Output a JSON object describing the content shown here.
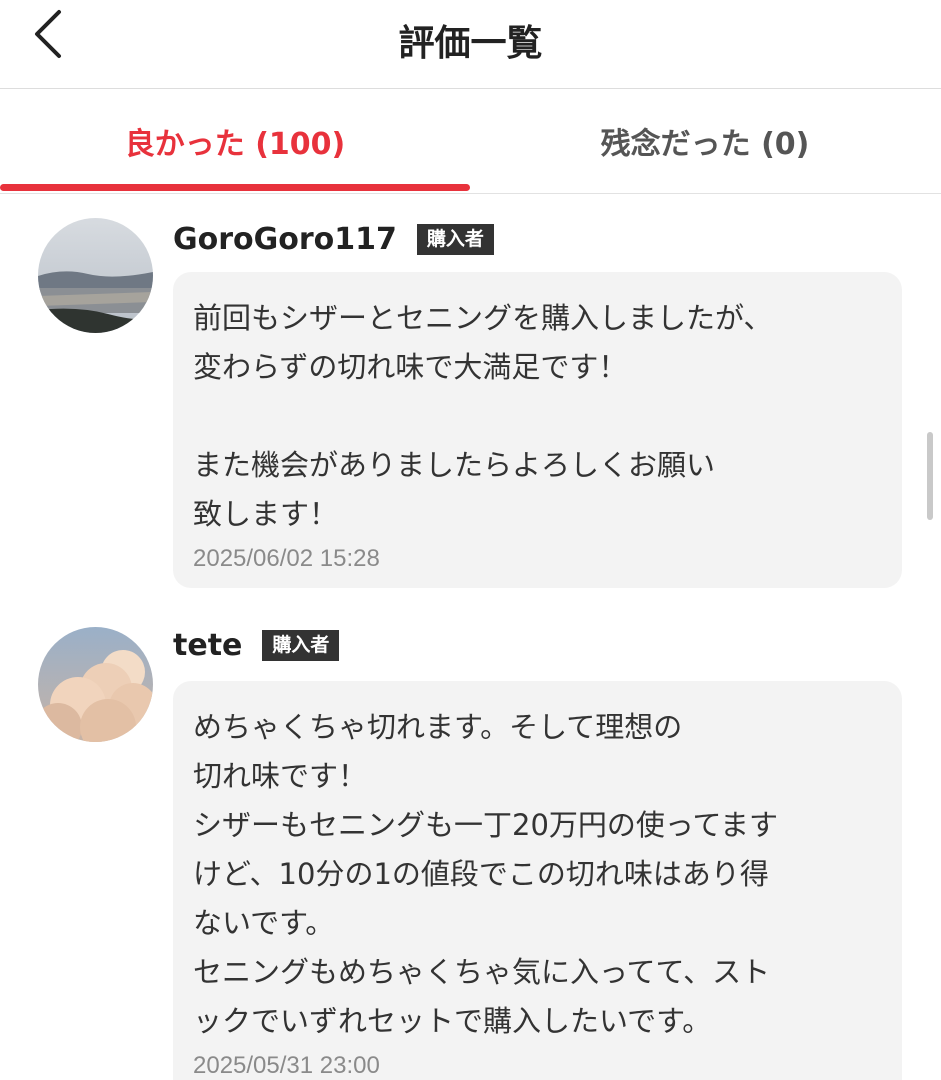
{
  "header": {
    "title": "評価一覧",
    "back_icon": "chevron-left-icon"
  },
  "tabs": [
    {
      "label": "良かった (100)",
      "active": true
    },
    {
      "label": "残念だった (0)",
      "active": false
    }
  ],
  "colors": {
    "accent": "#e8323c",
    "badge_bg": "#333333",
    "bubble_bg": "#f3f3f3"
  },
  "reviews": [
    {
      "username": "GoroGoro117",
      "badge": "購入者",
      "text": "前回もシザーとセニングを購入しましたが、\n変わらずの切れ味で大満足です！\n\nまた機会がありましたらよろしくお願い\n致します！",
      "date": "2025/06/02 15:28"
    },
    {
      "username": "tete",
      "badge": "購入者",
      "text": "めちゃくちゃ切れます。そして理想の\n切れ味です！\nシザーもセニングも一丁20万円の使ってます\nけど、10分の1の値段でこの切れ味はあり得\nないです。\nセニングもめちゃくちゃ気に入ってて、スト\nックでいずれセットで購入したいです。",
      "date": "2025/05/31 23:00"
    }
  ]
}
